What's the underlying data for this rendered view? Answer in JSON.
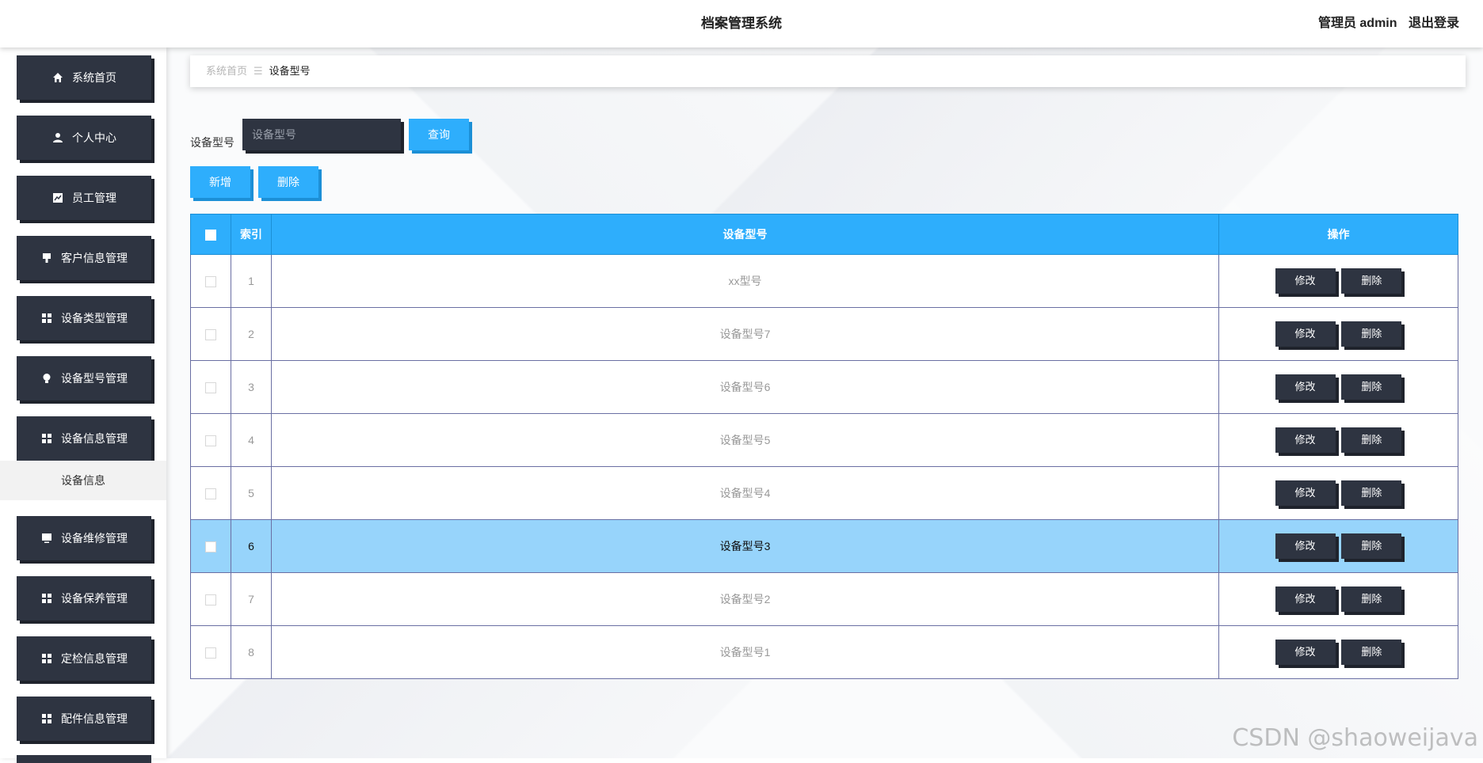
{
  "header": {
    "title": "档案管理系统",
    "user_label": "管理员 admin",
    "logout_label": "退出登录"
  },
  "sidebar": {
    "items": [
      {
        "label": "系统首页",
        "icon": "home-icon"
      },
      {
        "label": "个人中心",
        "icon": "user-icon"
      },
      {
        "label": "员工管理",
        "icon": "chart-icon"
      },
      {
        "label": "客户信息管理",
        "icon": "stamp-icon"
      },
      {
        "label": "设备类型管理",
        "icon": "grid-icon"
      },
      {
        "label": "设备型号管理",
        "icon": "bulb-icon"
      },
      {
        "label": "设备信息管理",
        "icon": "grid-icon"
      },
      {
        "label": "设备维修管理",
        "icon": "monitor-icon"
      },
      {
        "label": "设备保养管理",
        "icon": "grid-icon"
      },
      {
        "label": "定检信息管理",
        "icon": "grid-icon"
      },
      {
        "label": "配件信息管理",
        "icon": "grid-icon"
      }
    ],
    "sub_item": "设备信息"
  },
  "breadcrumb": {
    "home": "系统首页",
    "current": "设备型号"
  },
  "search": {
    "label": "设备型号",
    "placeholder": "设备型号",
    "query_button": "查询"
  },
  "toolbar": {
    "add_button": "新增",
    "delete_button": "删除"
  },
  "table": {
    "headers": {
      "index": "索引",
      "model": "设备型号",
      "actions": "操作"
    },
    "edit_label": "修改",
    "delete_label": "删除",
    "highlighted_row": 6,
    "rows": [
      {
        "index": "1",
        "model": "xx型号"
      },
      {
        "index": "2",
        "model": "设备型号7"
      },
      {
        "index": "3",
        "model": "设备型号6"
      },
      {
        "index": "4",
        "model": "设备型号5"
      },
      {
        "index": "5",
        "model": "设备型号4"
      },
      {
        "index": "6",
        "model": "设备型号3"
      },
      {
        "index": "7",
        "model": "设备型号2"
      },
      {
        "index": "8",
        "model": "设备型号1"
      }
    ]
  },
  "watermark": "CSDN @shaoweijava",
  "colors": {
    "accent": "#2eaefc",
    "dark": "#2e3441",
    "highlight_row": "#97d4fb"
  }
}
